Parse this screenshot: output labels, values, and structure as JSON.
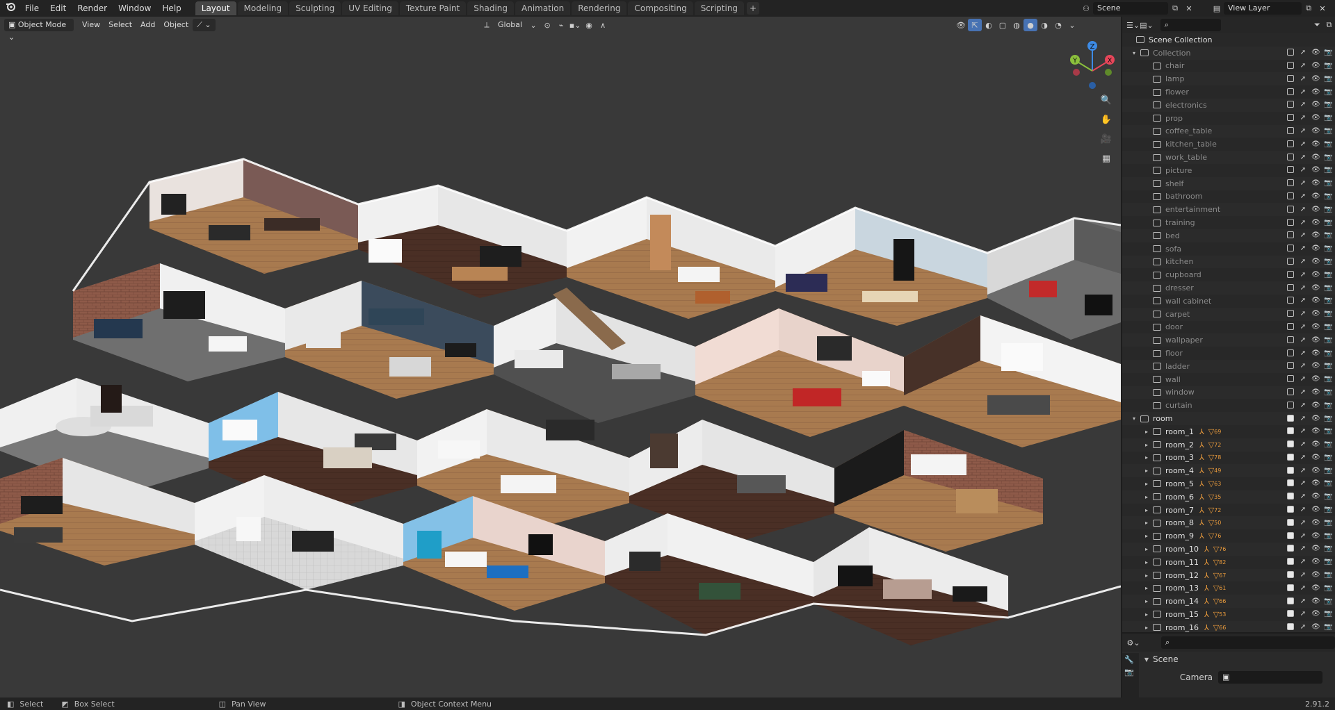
{
  "topbar": {
    "menus": [
      "File",
      "Edit",
      "Render",
      "Window",
      "Help"
    ],
    "workspaces": [
      "Layout",
      "Modeling",
      "Sculpting",
      "UV Editing",
      "Texture Paint",
      "Shading",
      "Animation",
      "Rendering",
      "Compositing",
      "Scripting"
    ],
    "active_workspace": "Layout",
    "add_tab": "+",
    "scene_name": "Scene",
    "view_layer": "View Layer"
  },
  "viewport": {
    "mode": "Object Mode",
    "menus": [
      "View",
      "Select",
      "Add",
      "Object"
    ],
    "transform_orientation": "Global",
    "gizmo": {
      "x": "X",
      "y": "Y",
      "z": "Z"
    }
  },
  "outliner": {
    "root": "Scene Collection",
    "collection": "Collection",
    "collection_children": [
      "chair",
      "lamp",
      "flower",
      "electronics",
      "prop",
      "coffee_table",
      "kitchen_table",
      "work_table",
      "picture",
      "shelf",
      "bathroom",
      "entertainment",
      "training",
      "bed",
      "sofa",
      "kitchen",
      "cupboard",
      "dresser",
      "wall cabinet",
      "carpet",
      "door",
      "wallpaper",
      "floor",
      "ladder",
      "wall",
      "window",
      "curtain"
    ],
    "room_collection": "room",
    "rooms": [
      {
        "name": "room_1",
        "count": "69"
      },
      {
        "name": "room_2",
        "count": "72"
      },
      {
        "name": "room_3",
        "count": "78"
      },
      {
        "name": "room_4",
        "count": "49"
      },
      {
        "name": "room_5",
        "count": "63"
      },
      {
        "name": "room_6",
        "count": "35"
      },
      {
        "name": "room_7",
        "count": "72"
      },
      {
        "name": "room_8",
        "count": "50"
      },
      {
        "name": "room_9",
        "count": "76"
      },
      {
        "name": "room_10",
        "count": "76"
      },
      {
        "name": "room_11",
        "count": "82"
      },
      {
        "name": "room_12",
        "count": "67"
      },
      {
        "name": "room_13",
        "count": "61"
      },
      {
        "name": "room_14",
        "count": "66"
      },
      {
        "name": "room_15",
        "count": "53"
      },
      {
        "name": "room_16",
        "count": "66"
      }
    ]
  },
  "properties": {
    "panel": "Scene",
    "camera_label": "Camera"
  },
  "statusbar": {
    "items": [
      "Select",
      "Box Select",
      "Pan View",
      "Object Context Menu"
    ],
    "version": "2.91.2"
  },
  "colors": {
    "accent": "#4772b3",
    "active_tab": "#474747",
    "modifier": "#e89a3c",
    "axis_x": "#e8465a",
    "axis_y": "#8bbf3c",
    "axis_z": "#3d8be6"
  }
}
